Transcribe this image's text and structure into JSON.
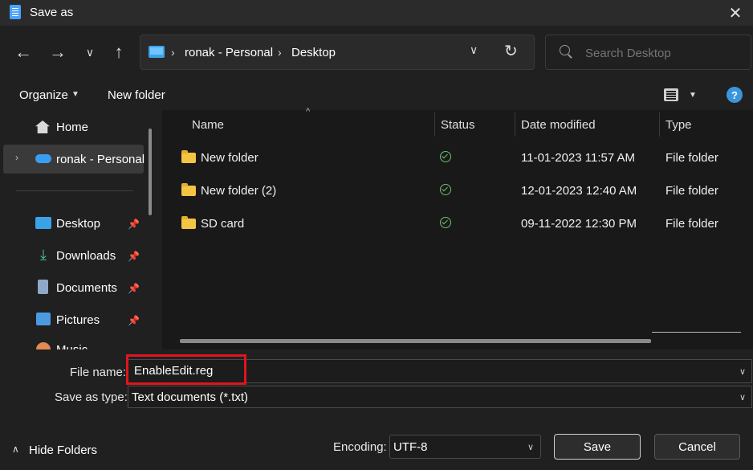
{
  "window": {
    "title": "Save as"
  },
  "address": {
    "crumbs": [
      "ronak - Personal",
      "Desktop"
    ],
    "separator": "›"
  },
  "search": {
    "placeholder": "Search Desktop"
  },
  "toolbar": {
    "organize_label": "Organize",
    "new_folder_label": "New folder"
  },
  "sidebar": {
    "items": [
      {
        "label": "Home",
        "icon": "home-icon"
      },
      {
        "label": "ronak - Personal",
        "icon": "onedrive-cloud-icon",
        "expanded": false,
        "selected": true
      },
      {
        "label": "Desktop",
        "icon": "desktop-icon",
        "pinned": true
      },
      {
        "label": "Downloads",
        "icon": "downloads-icon",
        "pinned": true
      },
      {
        "label": "Documents",
        "icon": "documents-icon",
        "pinned": true
      },
      {
        "label": "Pictures",
        "icon": "pictures-icon",
        "pinned": true
      },
      {
        "label": "Music",
        "icon": "music-icon",
        "pinned": false
      }
    ]
  },
  "columns": [
    "Name",
    "Status",
    "Date modified",
    "Type"
  ],
  "files": [
    {
      "name": "New folder",
      "status": "synced",
      "date": "11-01-2023 11:57 AM",
      "type": "File folder"
    },
    {
      "name": "New folder (2)",
      "status": "synced",
      "date": "12-01-2023 12:40 AM",
      "type": "File folder"
    },
    {
      "name": "SD card",
      "status": "synced",
      "date": "09-11-2022 12:30 PM",
      "type": "File folder"
    }
  ],
  "form": {
    "file_name_label": "File name:",
    "file_name_value": "EnableEdit.reg",
    "save_as_type_label": "Save as type:",
    "save_as_type_value": "Text documents (*.txt)",
    "encoding_label": "Encoding:",
    "encoding_value": "UTF-8",
    "hide_folders_label": "Hide Folders",
    "save_label": "Save",
    "cancel_label": "Cancel"
  },
  "colors": {
    "highlight_box": "#e0141e",
    "folder": "#f4c444",
    "status_ok": "#6cc070",
    "accent": "#3b95db"
  }
}
